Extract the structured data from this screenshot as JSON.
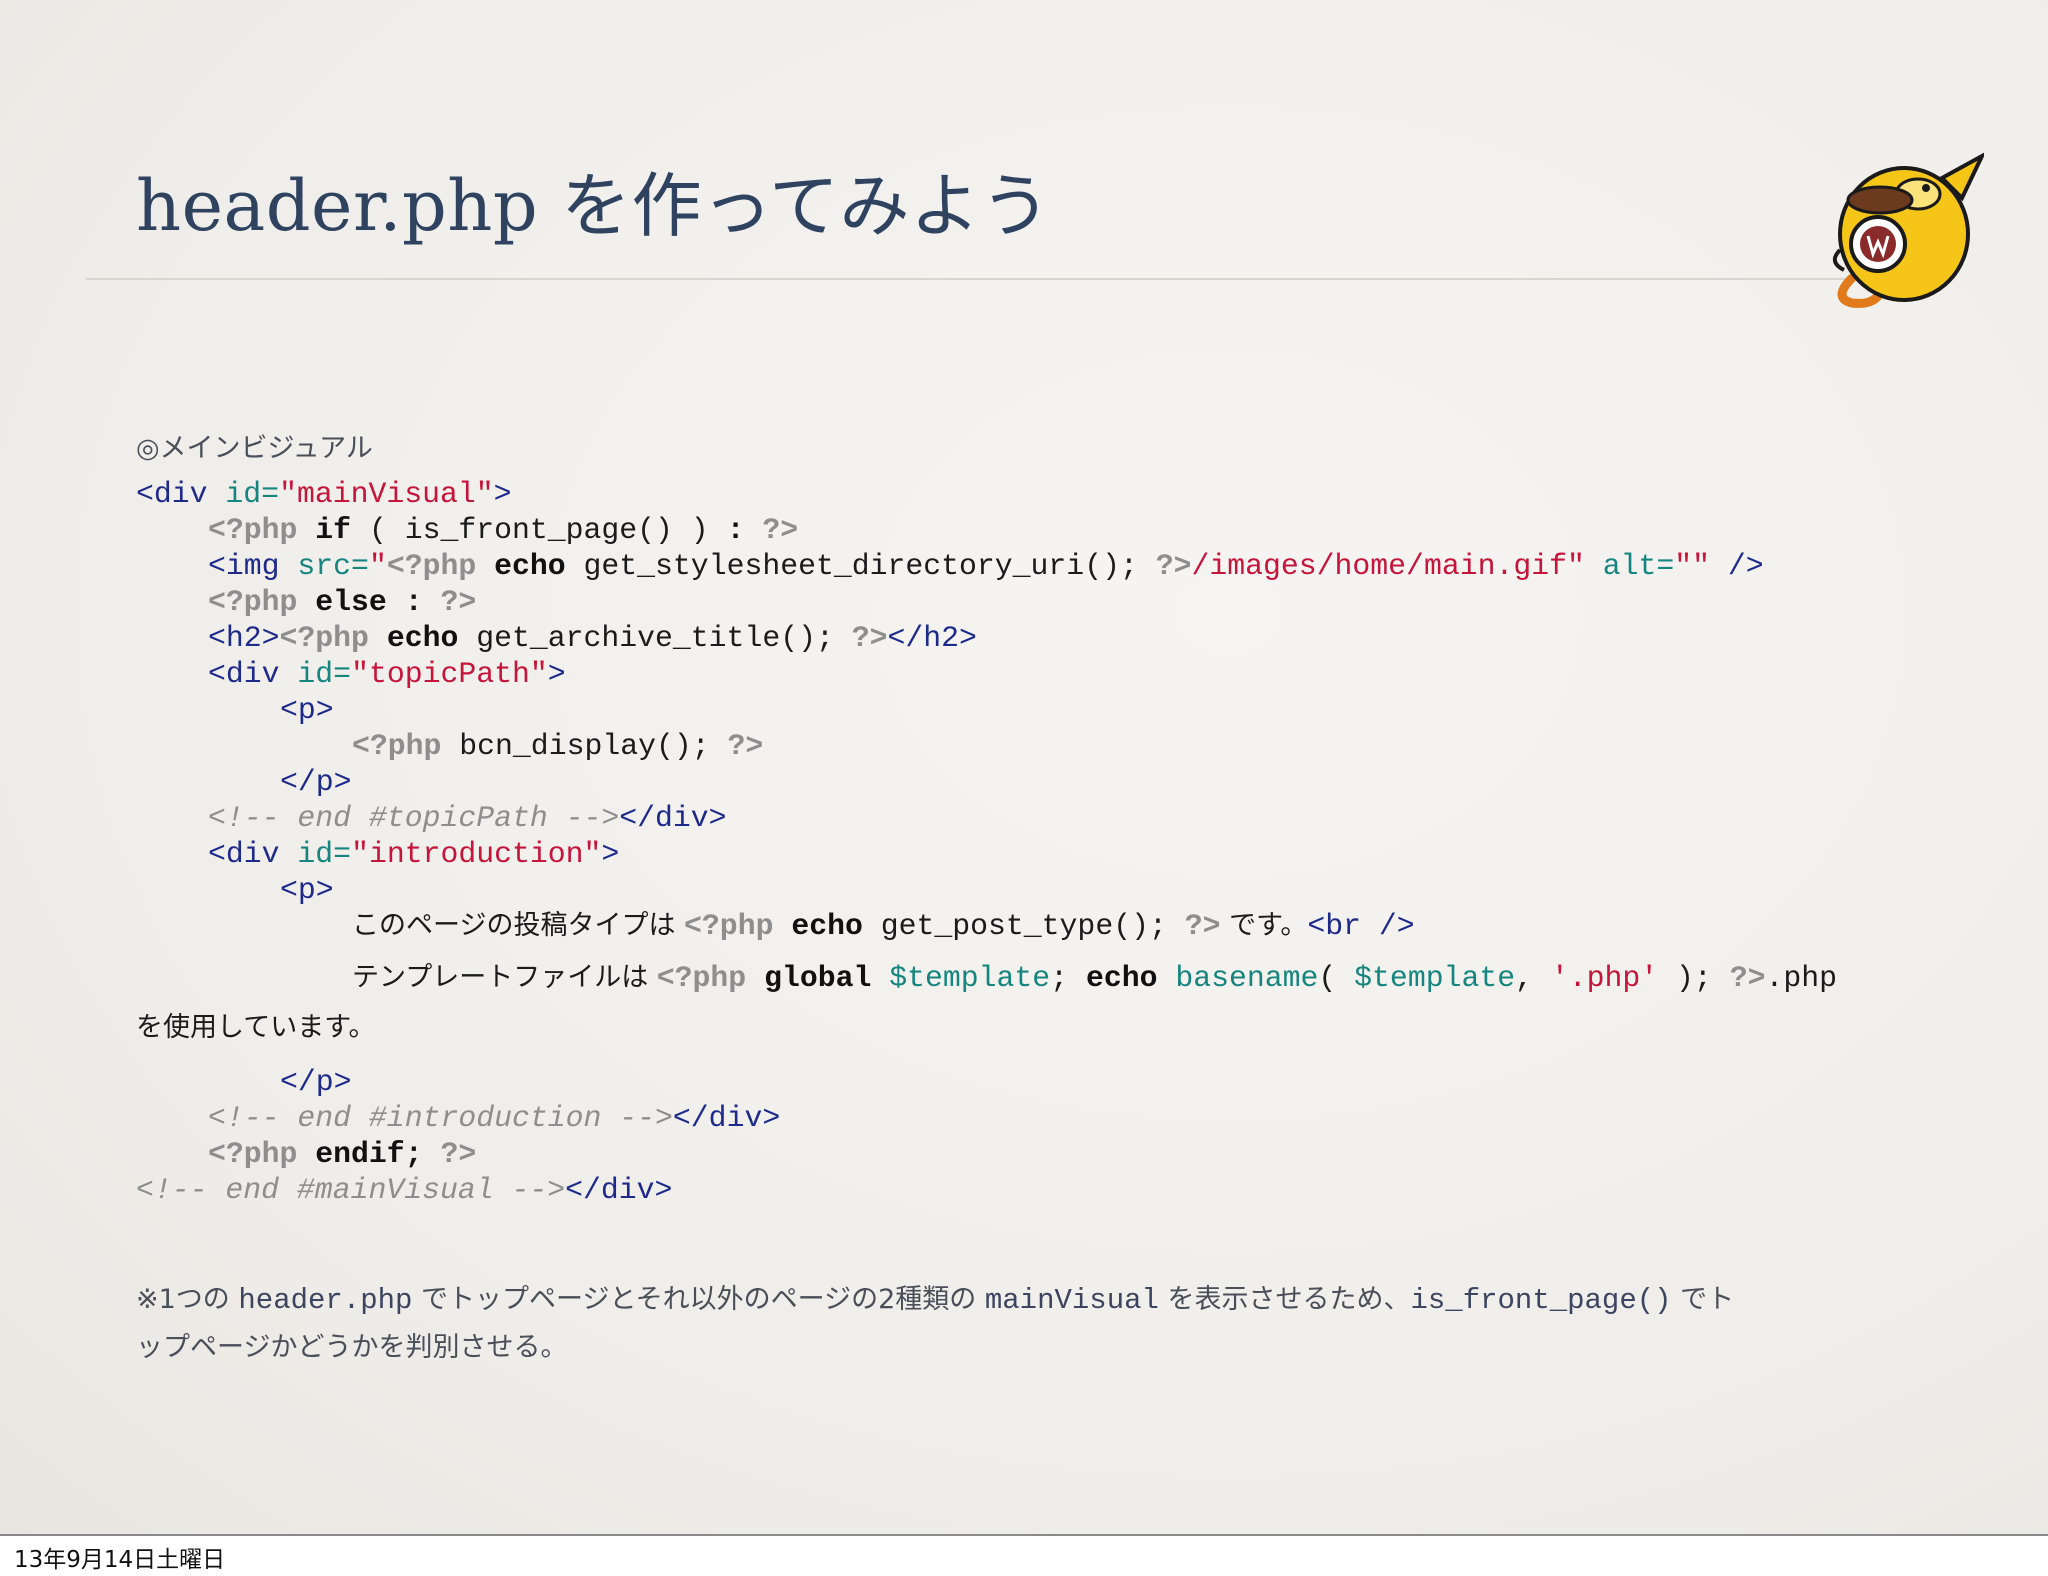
{
  "slide": {
    "title": "header.php を作ってみよう",
    "section_heading": "◎メインビジュアル",
    "mascot_icon": "wapuu-mascot-icon"
  },
  "code": {
    "l1": {
      "t1": "<div ",
      "a1": "id=",
      "s1": "\"mainVisual\"",
      "t2": ">"
    },
    "l2": {
      "p1": "<?php",
      "k1": " if",
      "x1": " ( is_front_page() ) ",
      "k2": ":",
      "p2": " ?>"
    },
    "l3": {
      "t1": "<img ",
      "a1": "src=",
      "s1": "\"",
      "p1": "<?php",
      "k1": " echo",
      "x1": " get_stylesheet_directory_uri(); ",
      "p2": "?>",
      "s2": "/images/home/main.gif\"",
      "a2": " alt=",
      "s3": "\"\"",
      "t2": " />"
    },
    "l4": {
      "p1": "<?php",
      "k1": " else :",
      "p2": " ?>"
    },
    "l5": {
      "t1": "<h2>",
      "p1": "<?php",
      "k1": " echo",
      "x1": " get_archive_title(); ",
      "p2": "?>",
      "t2": "</h2>"
    },
    "l6": {
      "t1": "<div ",
      "a1": "id=",
      "s1": "\"topicPath\"",
      "t2": ">"
    },
    "l7": {
      "t1": "<p>"
    },
    "l8": {
      "p1": "<?php",
      "x1": " bcn_display(); ",
      "p2": "?>"
    },
    "l9": {
      "t1": "</p>"
    },
    "l10": {
      "c1": "<!-- end #topicPath -->",
      "t1": "</div>"
    },
    "l11": {
      "t1": "<div ",
      "a1": "id=",
      "s1": "\"introduction\"",
      "t2": ">"
    },
    "l12": {
      "t1": "<p>"
    },
    "l13": {
      "j1": "このページの投稿タイプは ",
      "p1": "<?php",
      "k1": " echo",
      "x1": " get_post_type(); ",
      "p2": "?>",
      "j2": " です。",
      "t1": "<br />"
    },
    "l14": {
      "j1": "テンプレートファイルは ",
      "p1": "<?php",
      "k1": " global",
      "v1": " $template",
      "x1": "; ",
      "k2": "echo",
      "f1": " basename",
      "x2": "( ",
      "v2": "$template",
      "x3": ", ",
      "s1": "'.php'",
      "x4": " ); ",
      "p2": "?>",
      "x5": ".php"
    },
    "l15": {
      "j1": "を使用しています。"
    },
    "l16": {
      "t1": "</p>"
    },
    "l17": {
      "c1": "<!-- end #introduction -->",
      "t1": "</div>"
    },
    "l18": {
      "p1": "<?php",
      "k1": " endif;",
      "p2": " ?>"
    },
    "l19": {
      "c1": "<!-- end #mainVisual -->",
      "t1": "</div>"
    }
  },
  "note": {
    "line1_a": "※1つの ",
    "line1_b": "header.php",
    "line1_c": " でトップページとそれ以外のページの2種類の ",
    "line1_d": "mainVisual",
    "line1_e": " を表示させるため、",
    "line1_f": "is_front_page()",
    "line1_g": " でト",
    "line2": "ップページかどうかを判別させる。"
  },
  "footer": {
    "date": "13年9月14日土曜日"
  }
}
